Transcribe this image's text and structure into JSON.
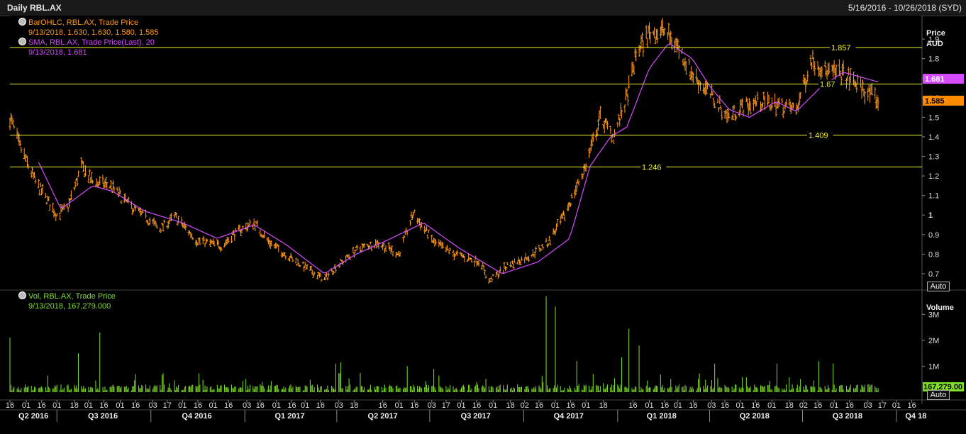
{
  "header": {
    "title": "Daily RBL.AX",
    "range": "5/16/2016 - 10/26/2018 (SYD)"
  },
  "price_panel": {
    "legend": [
      {
        "name": "BarOHLC, RBL.AX, Trade Price",
        "value": "9/13/2018, 1.630, 1.630, 1.580, 1.585",
        "color": "#ff9a1f"
      },
      {
        "name": "SMA, RBL.AX, Trade Price(Last), 20",
        "value": "9/13/2018, 1.681",
        "color": "#d64bff"
      }
    ],
    "axis_title": "Price",
    "axis_unit": "AUD",
    "auto_label": "Auto",
    "last_price_tag": "1.585",
    "sma_tag": "1.681"
  },
  "volume_panel": {
    "legend": [
      {
        "name": "Vol, RBL.AX, Trade Price",
        "value": "9/13/2018, 167,279.000",
        "color": "#7fe02a"
      }
    ],
    "axis_title": "Volume",
    "auto_label": "Auto",
    "last_volume_tag": "167,279.00"
  },
  "chart_data": [
    {
      "type": "ohlc",
      "title": "Daily RBL.AX",
      "ylabel": "Price AUD",
      "ylim": [
        0.62,
        2.02
      ],
      "yticks": [
        0.7,
        0.8,
        0.9,
        1,
        1.1,
        1.2,
        1.3,
        1.4,
        1.5,
        1.6,
        1.7,
        1.8,
        1.9
      ],
      "horizontal_lines": [
        {
          "value": 1.857,
          "label": "1.857"
        },
        {
          "value": 1.67,
          "label": "1.67"
        },
        {
          "value": 1.409,
          "label": "1.409"
        },
        {
          "value": 1.246,
          "label": "1.246"
        }
      ],
      "series": [
        {
          "name": "BarOHLC, RBL.AX, Trade Price",
          "type": "ohlc-bars",
          "color": "#ff9a1f",
          "keypoints": [
            [
              "2016-05-16",
              1.5
            ],
            [
              "2016-05-25",
              1.36
            ],
            [
              "2016-06-10",
              1.17
            ],
            [
              "2016-07-01",
              1.0
            ],
            [
              "2016-07-12",
              1.04
            ],
            [
              "2016-07-25",
              1.25
            ],
            [
              "2016-08-05",
              1.17
            ],
            [
              "2016-08-22",
              1.15
            ],
            [
              "2016-09-10",
              1.05
            ],
            [
              "2016-10-10",
              0.93
            ],
            [
              "2016-10-25",
              0.99
            ],
            [
              "2016-11-15",
              0.87
            ],
            [
              "2016-12-10",
              0.84
            ],
            [
              "2016-12-20",
              0.9
            ],
            [
              "2017-01-10",
              0.96
            ],
            [
              "2017-01-25",
              0.86
            ],
            [
              "2017-02-15",
              0.78
            ],
            [
              "2017-03-05",
              0.72
            ],
            [
              "2017-03-20",
              0.67
            ],
            [
              "2017-03-30",
              0.73
            ],
            [
              "2017-04-20",
              0.82
            ],
            [
              "2017-05-10",
              0.86
            ],
            [
              "2017-06-01",
              0.8
            ],
            [
              "2017-06-15",
              1.01
            ],
            [
              "2017-07-05",
              0.86
            ],
            [
              "2017-07-25",
              0.8
            ],
            [
              "2017-08-20",
              0.76
            ],
            [
              "2017-08-28",
              0.66
            ],
            [
              "2017-09-15",
              0.74
            ],
            [
              "2017-10-10",
              0.8
            ],
            [
              "2017-10-25",
              0.86
            ],
            [
              "2017-11-10",
              1.0
            ],
            [
              "2017-11-30",
              1.24
            ],
            [
              "2017-12-15",
              1.5
            ],
            [
              "2017-12-28",
              1.4
            ],
            [
              "2018-01-10",
              1.6
            ],
            [
              "2018-01-20",
              1.84
            ],
            [
              "2018-02-01",
              1.93
            ],
            [
              "2018-02-15",
              1.94
            ],
            [
              "2018-02-28",
              1.87
            ],
            [
              "2018-03-15",
              1.72
            ],
            [
              "2018-04-01",
              1.62
            ],
            [
              "2018-04-20",
              1.5
            ],
            [
              "2018-05-01",
              1.55
            ],
            [
              "2018-05-20",
              1.58
            ],
            [
              "2018-06-10",
              1.56
            ],
            [
              "2018-06-25",
              1.54
            ],
            [
              "2018-07-10",
              1.8
            ],
            [
              "2018-07-25",
              1.73
            ],
            [
              "2018-08-10",
              1.72
            ],
            [
              "2018-08-28",
              1.65
            ],
            [
              "2018-09-13",
              1.585
            ]
          ]
        },
        {
          "name": "SMA, RBL.AX, Trade Price(Last), 20",
          "type": "line",
          "color": "#d64bff",
          "points": [
            [
              "2016-06-13",
              1.27
            ],
            [
              "2016-07-05",
              1.03
            ],
            [
              "2016-08-05",
              1.15
            ],
            [
              "2016-08-25",
              1.12
            ],
            [
              "2016-09-25",
              1.02
            ],
            [
              "2016-11-01",
              0.96
            ],
            [
              "2016-12-05",
              0.88
            ],
            [
              "2017-01-10",
              0.95
            ],
            [
              "2017-02-10",
              0.85
            ],
            [
              "2017-03-20",
              0.7
            ],
            [
              "2017-04-20",
              0.8
            ],
            [
              "2017-05-20",
              0.87
            ],
            [
              "2017-06-25",
              0.96
            ],
            [
              "2017-07-30",
              0.83
            ],
            [
              "2017-09-10",
              0.7
            ],
            [
              "2017-10-15",
              0.76
            ],
            [
              "2017-11-15",
              0.88
            ],
            [
              "2017-12-05",
              1.25
            ],
            [
              "2017-12-25",
              1.4
            ],
            [
              "2018-01-10",
              1.45
            ],
            [
              "2018-02-01",
              1.75
            ],
            [
              "2018-02-20",
              1.88
            ],
            [
              "2018-03-15",
              1.8
            ],
            [
              "2018-04-01",
              1.66
            ],
            [
              "2018-04-20",
              1.54
            ],
            [
              "2018-05-10",
              1.5
            ],
            [
              "2018-06-05",
              1.58
            ],
            [
              "2018-06-25",
              1.53
            ],
            [
              "2018-07-20",
              1.66
            ],
            [
              "2018-08-10",
              1.73
            ],
            [
              "2018-09-13",
              1.681
            ]
          ]
        }
      ]
    },
    {
      "type": "bar",
      "ylabel": "Volume",
      "ylim": [
        0,
        3800000
      ],
      "yticks": [
        {
          "value": 1000000,
          "label": "1M"
        },
        {
          "value": 2000000,
          "label": "2M"
        },
        {
          "value": 3000000,
          "label": "3M"
        }
      ],
      "series": [
        {
          "name": "Vol, RBL.AX, Trade Price",
          "color": "#7fe02a",
          "baseline": 150000,
          "spikes": [
            [
              "2016-05-16",
              2100000
            ],
            [
              "2016-07-22",
              1500000
            ],
            [
              "2016-08-12",
              2300000
            ],
            [
              "2017-03-31",
              1100000
            ],
            [
              "2017-04-05",
              1150000
            ],
            [
              "2017-06-09",
              1000000
            ],
            [
              "2017-07-05",
              900000
            ],
            [
              "2017-10-23",
              3700000
            ],
            [
              "2017-11-01",
              3300000
            ],
            [
              "2017-11-22",
              1200000
            ],
            [
              "2018-01-05",
              1350000
            ],
            [
              "2018-01-12",
              2450000
            ],
            [
              "2018-01-22",
              1800000
            ],
            [
              "2018-04-06",
              1100000
            ],
            [
              "2018-06-06",
              1100000
            ],
            [
              "2018-07-17",
              1200000
            ],
            [
              "2018-07-31",
              1100000
            ],
            [
              "2018-09-13",
              167279
            ]
          ]
        }
      ]
    }
  ],
  "x_axis": {
    "day_ticks": [
      [
        "2016-05-16",
        "16"
      ],
      [
        "2016-06-01",
        "01"
      ],
      [
        "2016-06-16",
        "16"
      ],
      [
        "2016-07-01",
        "01"
      ],
      [
        "2016-07-18",
        "18"
      ],
      [
        "2016-08-01",
        "01"
      ],
      [
        "2016-08-16",
        "16"
      ],
      [
        "2016-09-01",
        "01"
      ],
      [
        "2016-09-16",
        "16"
      ],
      [
        "2016-10-03",
        "03"
      ],
      [
        "2016-10-17",
        "17"
      ],
      [
        "2016-11-01",
        "01"
      ],
      [
        "2016-11-16",
        "16"
      ],
      [
        "2016-12-01",
        "01"
      ],
      [
        "2016-12-16",
        "16"
      ],
      [
        "2017-01-03",
        "03"
      ],
      [
        "2017-01-16",
        "16"
      ],
      [
        "2017-02-01",
        "01"
      ],
      [
        "2017-02-16",
        "16"
      ],
      [
        "2017-03-01",
        "01"
      ],
      [
        "2017-03-16",
        "16"
      ],
      [
        "2017-04-03",
        "03"
      ],
      [
        "2017-04-18",
        "18"
      ],
      [
        "2017-05-16",
        "16"
      ],
      [
        "2017-06-01",
        "01"
      ],
      [
        "2017-06-16",
        "16"
      ],
      [
        "2017-07-03",
        "03"
      ],
      [
        "2017-07-17",
        "17"
      ],
      [
        "2017-08-01",
        "01"
      ],
      [
        "2017-08-16",
        "16"
      ],
      [
        "2017-09-01",
        "01"
      ],
      [
        "2017-09-18",
        "18"
      ],
      [
        "2017-10-02",
        "02"
      ],
      [
        "2017-10-16",
        "16"
      ],
      [
        "2017-11-01",
        "01"
      ],
      [
        "2017-11-16",
        "16"
      ],
      [
        "2017-12-01",
        "01"
      ],
      [
        "2017-12-18",
        "18"
      ],
      [
        "2018-01-16",
        "16"
      ],
      [
        "2018-02-01",
        "01"
      ],
      [
        "2018-02-16",
        "16"
      ],
      [
        "2018-03-01",
        "01"
      ],
      [
        "2018-03-16",
        "16"
      ],
      [
        "2018-04-03",
        "03"
      ],
      [
        "2018-04-16",
        "16"
      ],
      [
        "2018-05-01",
        "01"
      ],
      [
        "2018-05-16",
        "16"
      ],
      [
        "2018-06-01",
        "01"
      ],
      [
        "2018-06-18",
        "18"
      ],
      [
        "2018-07-02",
        "02"
      ],
      [
        "2018-07-16",
        "16"
      ],
      [
        "2018-08-01",
        "01"
      ],
      [
        "2018-08-16",
        "16"
      ],
      [
        "2018-09-03",
        "03"
      ],
      [
        "2018-09-17",
        "17"
      ],
      [
        "2018-10-01",
        "01"
      ],
      [
        "2018-10-16",
        "16"
      ]
    ],
    "quarters": [
      [
        "2016-06-08",
        "Q2 2016"
      ],
      [
        "2016-08-15",
        "Q3 2016"
      ],
      [
        "2016-11-15",
        "Q4 2016"
      ],
      [
        "2017-02-14",
        "Q1 2017"
      ],
      [
        "2017-05-16",
        "Q2 2017"
      ],
      [
        "2017-08-15",
        "Q3 2017"
      ],
      [
        "2017-11-14",
        "Q4 2017"
      ],
      [
        "2018-02-13",
        "Q1 2018"
      ],
      [
        "2018-05-15",
        "Q2 2018"
      ],
      [
        "2018-08-14",
        "Q3 2018"
      ],
      [
        "2018-10-20",
        "Q4 18"
      ]
    ],
    "quarter_boundaries": [
      "2016-07-01",
      "2016-10-01",
      "2017-01-01",
      "2017-04-01",
      "2017-07-01",
      "2017-10-01",
      "2018-01-01",
      "2018-04-01",
      "2018-07-01",
      "2018-10-01"
    ]
  }
}
